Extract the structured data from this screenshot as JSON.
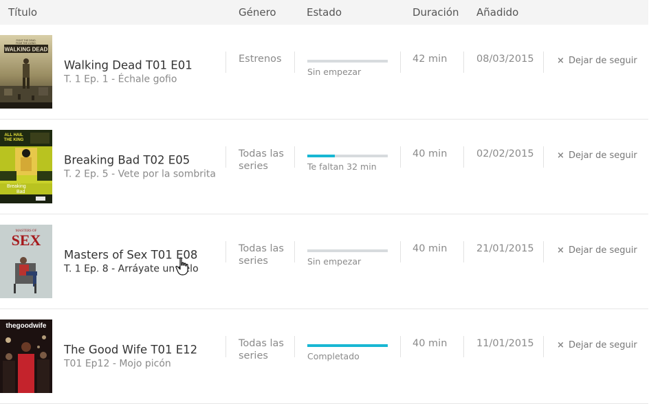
{
  "header": {
    "title": "Título",
    "genre": "Género",
    "status": "Estado",
    "duration": "Duración",
    "added": "Añadido"
  },
  "rows": [
    {
      "title": "Walking Dead T01 E01",
      "subtitle": "T. 1 Ep. 1 - Échale gofio",
      "genre": "Estrenos",
      "progress": 0,
      "status": "Sin empezar",
      "duration": "42 min",
      "added": "08/03/2015",
      "unfollow": "Dejar de seguir",
      "poster_icon": "walking-dead-poster"
    },
    {
      "title": "Breaking Bad T02 E05",
      "subtitle": "T. 2 Ep. 5 - Vete por la sombrita",
      "genre": "Todas las series",
      "progress": 0.34,
      "status": "Te faltan 32 min",
      "duration": "40 min",
      "added": "02/02/2015",
      "unfollow": "Dejar de seguir",
      "poster_icon": "breaking-bad-poster"
    },
    {
      "title": "Masters of Sex T01 E08",
      "subtitle": "T. 1 Ep. 8 - Arráyate un pelo",
      "genre": "Todas las series",
      "progress": 0,
      "status": "Sin empezar",
      "duration": "40 min",
      "added": "21/01/2015",
      "unfollow": "Dejar de seguir",
      "poster_icon": "masters-of-sex-poster"
    },
    {
      "title": "The Good Wife T01 E12",
      "subtitle": "T01 Ep12 - Mojo picón",
      "genre": "Todas las series",
      "progress": 1,
      "status": "Completado",
      "duration": "40 min",
      "added": "11/01/2015",
      "unfollow": "Dejar de seguir",
      "poster_icon": "the-good-wife-poster"
    }
  ],
  "posters": {
    "walking_dead": {
      "line1": "FIGHT THE DEAD.",
      "line2": "FEAR THE LIVING.",
      "title": "WALKING DEAD"
    },
    "breaking_bad": {
      "line1": "ALL HAIL",
      "line2": "THE KING",
      "title1": "Breaking",
      "title2": "Bad"
    },
    "masters_of_sex": {
      "line1": "MASTERS OF",
      "title": "SEX"
    },
    "good_wife": {
      "title": "thegoodwife"
    }
  },
  "colors": {
    "progress_fill": "#18b7d3",
    "progress_track": "#d7dbde",
    "header_bg": "#f4f4f4"
  }
}
